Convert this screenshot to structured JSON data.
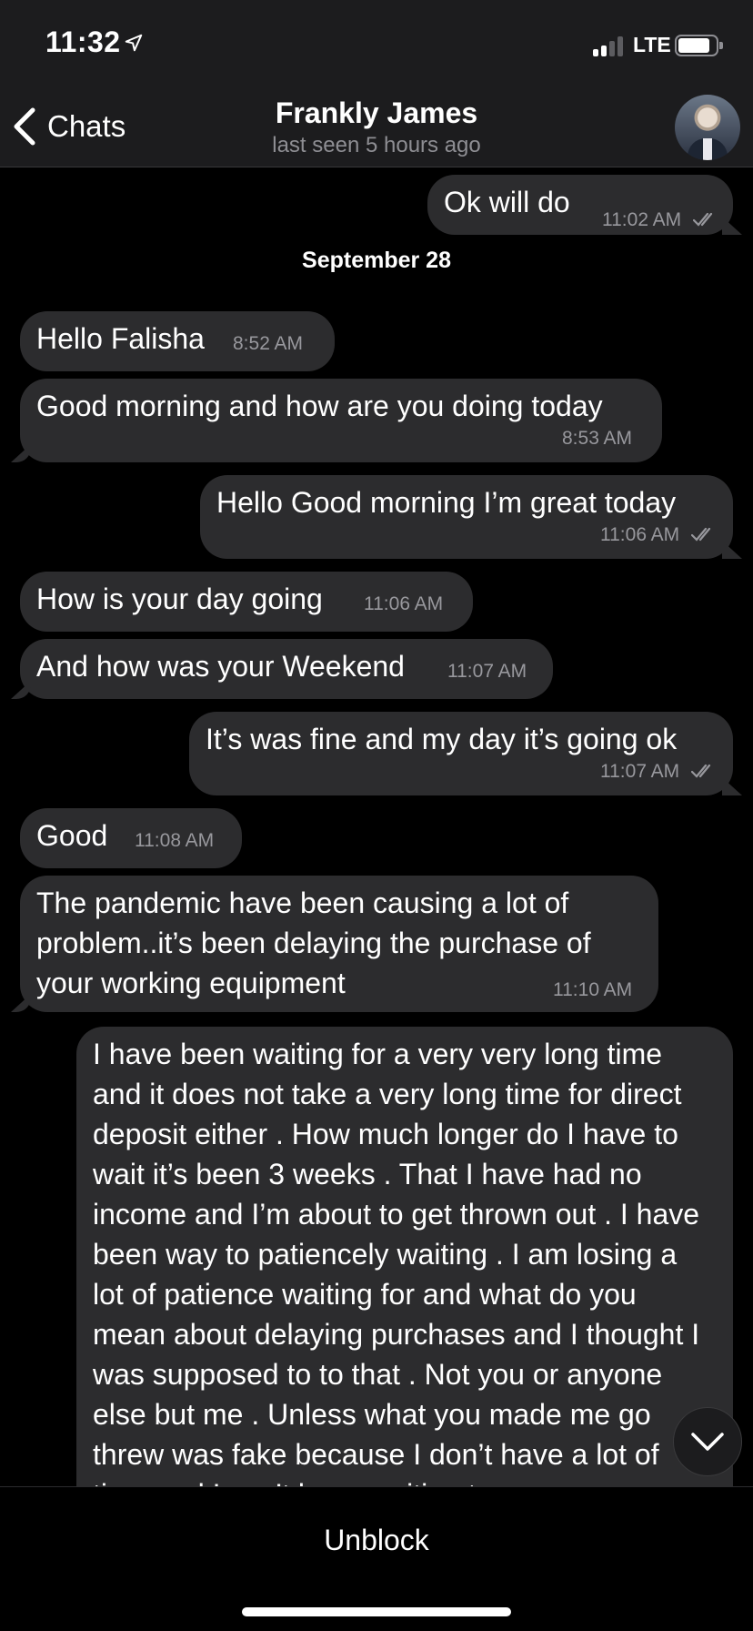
{
  "status_bar": {
    "time": "11:32",
    "network": "LTE"
  },
  "header": {
    "back_label": "Chats",
    "contact_name": "Frankly James",
    "last_seen": "last seen 5 hours ago"
  },
  "date_separator": "September 28",
  "messages": [
    {
      "direction": "outgoing",
      "text": "Ok will do",
      "time": "11:02 AM",
      "read": true
    },
    {
      "direction": "incoming",
      "text": "Hello Falisha",
      "time": "8:52 AM"
    },
    {
      "direction": "incoming",
      "text": "Good morning and how are you doing today",
      "time": "8:53 AM"
    },
    {
      "direction": "outgoing",
      "text": "Hello Good morning I’m great today",
      "time": "11:06 AM",
      "read": true
    },
    {
      "direction": "incoming",
      "text": "How is your day going",
      "time": "11:06 AM"
    },
    {
      "direction": "incoming",
      "text": "And how was your Weekend",
      "time": "11:07 AM"
    },
    {
      "direction": "outgoing",
      "text": "It’s was fine and my day it’s going ok",
      "time": "11:07 AM",
      "read": true
    },
    {
      "direction": "incoming",
      "text": "Good",
      "time": "11:08 AM"
    },
    {
      "direction": "incoming",
      "text": "The pandemic have been causing a lot of problem..it’s been delaying the purchase of your working equipment",
      "time": "11:10 AM"
    },
    {
      "direction": "outgoing",
      "text": "I have been waiting for a very very long time and it does not take a very long time for direct deposit either . How much longer do I have to wait it’s been 3 weeks . That I have had no income and I’m about to get thrown out . I have been way to patiencely waiting . I am losing a lot of patience waiting for  and what do you mean about delaying purchases and I thought I was supposed to to that . Not you or anyone else but me . Unless what you made me go threw was fake because I don’t have a lot of time and I can’t keep waiting to"
    }
  ],
  "footer": {
    "unblock_label": "Unblock"
  },
  "colors": {
    "bubble": "#2c2c2e",
    "background": "#000000",
    "header": "#1c1c1e",
    "meta": "#98989d"
  }
}
